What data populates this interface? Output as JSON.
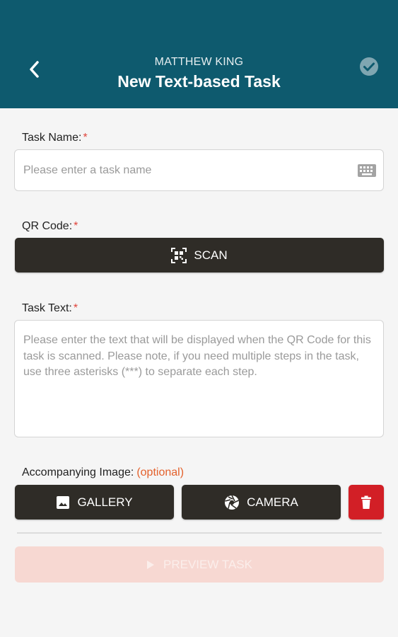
{
  "header": {
    "subtitle": "MATTHEW KING",
    "title": "New Text-based Task",
    "back_icon": "chevron-left-icon",
    "confirm_icon": "check-circle-icon",
    "bg_color": "#0e5a6e"
  },
  "form": {
    "task_name": {
      "label": "Task Name:",
      "required_mark": "*",
      "placeholder": "Please enter a task name",
      "icon": "keyboard-icon"
    },
    "qr_code": {
      "label": "QR Code:",
      "required_mark": "*",
      "scan_label": "SCAN",
      "icon": "qr-scan-icon"
    },
    "task_text": {
      "label": "Task Text:",
      "required_mark": "*",
      "placeholder": "Please enter the text that will be displayed when the QR Code for this task is scanned.  Please note, if you need multiple steps in the task, use three asterisks (***) to separate each step."
    },
    "image": {
      "label": "Accompanying Image:",
      "optional_label": "(optional)",
      "gallery_label": "GALLERY",
      "camera_label": "CAMERA",
      "gallery_icon": "image-icon",
      "camera_icon": "camera-shutter-icon",
      "delete_icon": "trash-icon"
    }
  },
  "preview": {
    "label": "PREVIEW TASK",
    "icon": "play-icon"
  },
  "colors": {
    "button_dark": "#2f2c27",
    "danger": "#d21f26",
    "required": "#e0443b",
    "optional": "#e4612c",
    "preview_disabled": "#f7d8d2"
  }
}
